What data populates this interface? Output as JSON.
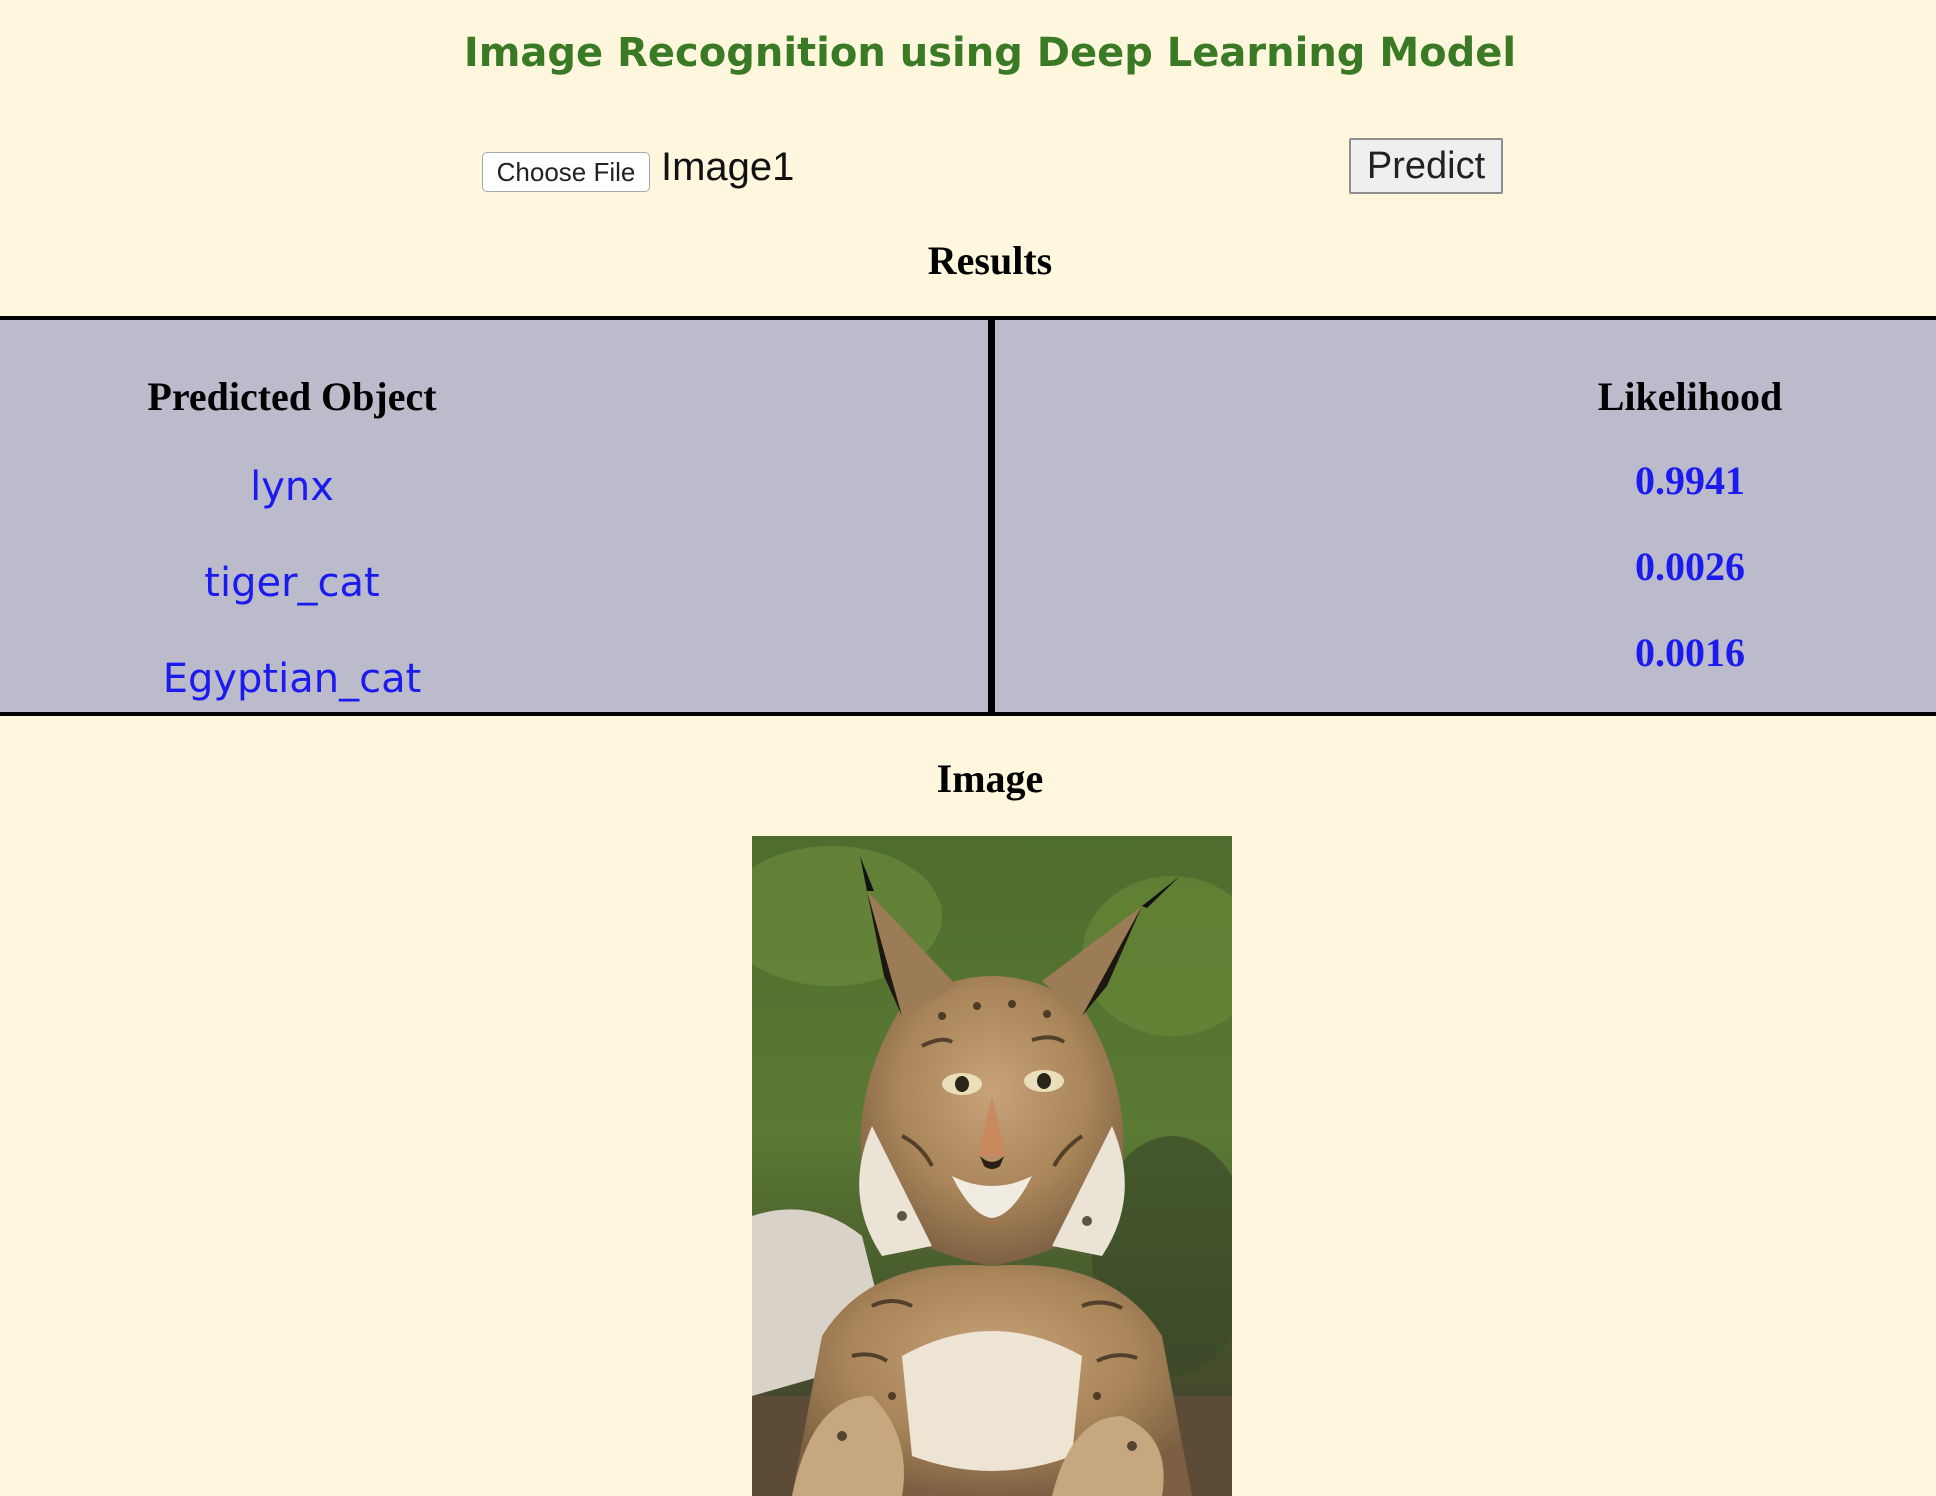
{
  "page": {
    "title": "Image Recognition using Deep Learning Model"
  },
  "upload": {
    "choose_file_label": "Choose File",
    "file_name": "Image1",
    "predict_label": "Predict"
  },
  "results": {
    "heading": "Results",
    "columns": [
      "Predicted Object",
      "Likelihood"
    ],
    "rows": [
      {
        "object": "lynx",
        "likelihood": "0.9941"
      },
      {
        "object": "tiger_cat",
        "likelihood": "0.0026"
      },
      {
        "object": "Egyptian_cat",
        "likelihood": "0.0016"
      }
    ]
  },
  "image_section": {
    "heading": "Image"
  },
  "colors": {
    "background": "#fef7de",
    "title": "#3a7a25",
    "table_background": "#bcbbcc",
    "result_text": "#1b1bf0"
  }
}
